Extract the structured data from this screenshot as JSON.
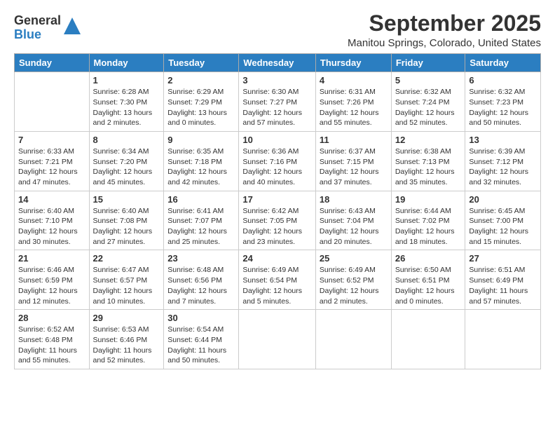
{
  "header": {
    "logo_general": "General",
    "logo_blue": "Blue",
    "month": "September 2025",
    "location": "Manitou Springs, Colorado, United States"
  },
  "weekdays": [
    "Sunday",
    "Monday",
    "Tuesday",
    "Wednesday",
    "Thursday",
    "Friday",
    "Saturday"
  ],
  "weeks": [
    [
      {
        "day": "",
        "sunrise": "",
        "sunset": "",
        "daylight": ""
      },
      {
        "day": "1",
        "sunrise": "Sunrise: 6:28 AM",
        "sunset": "Sunset: 7:30 PM",
        "daylight": "Daylight: 13 hours and 2 minutes."
      },
      {
        "day": "2",
        "sunrise": "Sunrise: 6:29 AM",
        "sunset": "Sunset: 7:29 PM",
        "daylight": "Daylight: 13 hours and 0 minutes."
      },
      {
        "day": "3",
        "sunrise": "Sunrise: 6:30 AM",
        "sunset": "Sunset: 7:27 PM",
        "daylight": "Daylight: 12 hours and 57 minutes."
      },
      {
        "day": "4",
        "sunrise": "Sunrise: 6:31 AM",
        "sunset": "Sunset: 7:26 PM",
        "daylight": "Daylight: 12 hours and 55 minutes."
      },
      {
        "day": "5",
        "sunrise": "Sunrise: 6:32 AM",
        "sunset": "Sunset: 7:24 PM",
        "daylight": "Daylight: 12 hours and 52 minutes."
      },
      {
        "day": "6",
        "sunrise": "Sunrise: 6:32 AM",
        "sunset": "Sunset: 7:23 PM",
        "daylight": "Daylight: 12 hours and 50 minutes."
      }
    ],
    [
      {
        "day": "7",
        "sunrise": "Sunrise: 6:33 AM",
        "sunset": "Sunset: 7:21 PM",
        "daylight": "Daylight: 12 hours and 47 minutes."
      },
      {
        "day": "8",
        "sunrise": "Sunrise: 6:34 AM",
        "sunset": "Sunset: 7:20 PM",
        "daylight": "Daylight: 12 hours and 45 minutes."
      },
      {
        "day": "9",
        "sunrise": "Sunrise: 6:35 AM",
        "sunset": "Sunset: 7:18 PM",
        "daylight": "Daylight: 12 hours and 42 minutes."
      },
      {
        "day": "10",
        "sunrise": "Sunrise: 6:36 AM",
        "sunset": "Sunset: 7:16 PM",
        "daylight": "Daylight: 12 hours and 40 minutes."
      },
      {
        "day": "11",
        "sunrise": "Sunrise: 6:37 AM",
        "sunset": "Sunset: 7:15 PM",
        "daylight": "Daylight: 12 hours and 37 minutes."
      },
      {
        "day": "12",
        "sunrise": "Sunrise: 6:38 AM",
        "sunset": "Sunset: 7:13 PM",
        "daylight": "Daylight: 12 hours and 35 minutes."
      },
      {
        "day": "13",
        "sunrise": "Sunrise: 6:39 AM",
        "sunset": "Sunset: 7:12 PM",
        "daylight": "Daylight: 12 hours and 32 minutes."
      }
    ],
    [
      {
        "day": "14",
        "sunrise": "Sunrise: 6:40 AM",
        "sunset": "Sunset: 7:10 PM",
        "daylight": "Daylight: 12 hours and 30 minutes."
      },
      {
        "day": "15",
        "sunrise": "Sunrise: 6:40 AM",
        "sunset": "Sunset: 7:08 PM",
        "daylight": "Daylight: 12 hours and 27 minutes."
      },
      {
        "day": "16",
        "sunrise": "Sunrise: 6:41 AM",
        "sunset": "Sunset: 7:07 PM",
        "daylight": "Daylight: 12 hours and 25 minutes."
      },
      {
        "day": "17",
        "sunrise": "Sunrise: 6:42 AM",
        "sunset": "Sunset: 7:05 PM",
        "daylight": "Daylight: 12 hours and 23 minutes."
      },
      {
        "day": "18",
        "sunrise": "Sunrise: 6:43 AM",
        "sunset": "Sunset: 7:04 PM",
        "daylight": "Daylight: 12 hours and 20 minutes."
      },
      {
        "day": "19",
        "sunrise": "Sunrise: 6:44 AM",
        "sunset": "Sunset: 7:02 PM",
        "daylight": "Daylight: 12 hours and 18 minutes."
      },
      {
        "day": "20",
        "sunrise": "Sunrise: 6:45 AM",
        "sunset": "Sunset: 7:00 PM",
        "daylight": "Daylight: 12 hours and 15 minutes."
      }
    ],
    [
      {
        "day": "21",
        "sunrise": "Sunrise: 6:46 AM",
        "sunset": "Sunset: 6:59 PM",
        "daylight": "Daylight: 12 hours and 12 minutes."
      },
      {
        "day": "22",
        "sunrise": "Sunrise: 6:47 AM",
        "sunset": "Sunset: 6:57 PM",
        "daylight": "Daylight: 12 hours and 10 minutes."
      },
      {
        "day": "23",
        "sunrise": "Sunrise: 6:48 AM",
        "sunset": "Sunset: 6:56 PM",
        "daylight": "Daylight: 12 hours and 7 minutes."
      },
      {
        "day": "24",
        "sunrise": "Sunrise: 6:49 AM",
        "sunset": "Sunset: 6:54 PM",
        "daylight": "Daylight: 12 hours and 5 minutes."
      },
      {
        "day": "25",
        "sunrise": "Sunrise: 6:49 AM",
        "sunset": "Sunset: 6:52 PM",
        "daylight": "Daylight: 12 hours and 2 minutes."
      },
      {
        "day": "26",
        "sunrise": "Sunrise: 6:50 AM",
        "sunset": "Sunset: 6:51 PM",
        "daylight": "Daylight: 12 hours and 0 minutes."
      },
      {
        "day": "27",
        "sunrise": "Sunrise: 6:51 AM",
        "sunset": "Sunset: 6:49 PM",
        "daylight": "Daylight: 11 hours and 57 minutes."
      }
    ],
    [
      {
        "day": "28",
        "sunrise": "Sunrise: 6:52 AM",
        "sunset": "Sunset: 6:48 PM",
        "daylight": "Daylight: 11 hours and 55 minutes."
      },
      {
        "day": "29",
        "sunrise": "Sunrise: 6:53 AM",
        "sunset": "Sunset: 6:46 PM",
        "daylight": "Daylight: 11 hours and 52 minutes."
      },
      {
        "day": "30",
        "sunrise": "Sunrise: 6:54 AM",
        "sunset": "Sunset: 6:44 PM",
        "daylight": "Daylight: 11 hours and 50 minutes."
      },
      {
        "day": "",
        "sunrise": "",
        "sunset": "",
        "daylight": ""
      },
      {
        "day": "",
        "sunrise": "",
        "sunset": "",
        "daylight": ""
      },
      {
        "day": "",
        "sunrise": "",
        "sunset": "",
        "daylight": ""
      },
      {
        "day": "",
        "sunrise": "",
        "sunset": "",
        "daylight": ""
      }
    ]
  ]
}
